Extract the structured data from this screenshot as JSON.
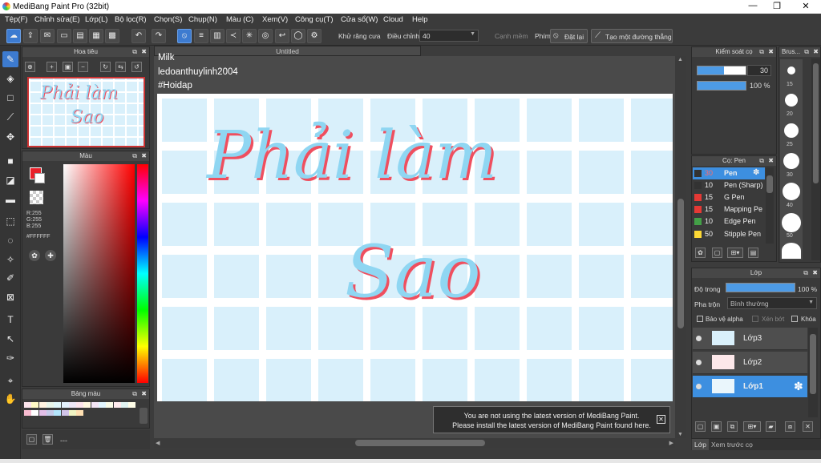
{
  "window": {
    "title": "MediBang Paint Pro (32bit)",
    "minimize": "—",
    "maximize": "❐",
    "close": "✕"
  },
  "menu": [
    "Tệp(F)",
    "Chỉnh sửa(E)",
    "Lớp(L)",
    "Bộ lọc(R)",
    "Chọn(S)",
    "Chụp(N)",
    "Màu (C)",
    "Xem(V)",
    "Công cụ(T)",
    "Cửa sổ(W)",
    "Cloud",
    "Help"
  ],
  "toolbar": {
    "antialias_label": "Khử răng cưa",
    "adjust_label": "Điều chỉnh",
    "adjust_value": "40",
    "edge_label": "Cạnh mềm",
    "phim_label": "Phím",
    "reset_label": "Đặt lại",
    "create_line_label": "Tạo một đường thẳng"
  },
  "document": {
    "tab_title": "Untitled"
  },
  "navigator": {
    "title": "Hoa tiêu",
    "preview_line1": "Phải làm",
    "preview_line2": "Sao"
  },
  "color_panel": {
    "title": "Màu",
    "r": "R:255",
    "g": "G:255",
    "b": "B:255",
    "hex": "#FFFFFF",
    "primary": "#e8202a",
    "secondary": "#ffffff"
  },
  "palette_panel": {
    "title": "Bảng màu",
    "bottom_text": "---",
    "row1": [
      "#fce4ec",
      "#fff9c4",
      "#fff3e0",
      "#e8f5e9",
      "#e0f7fa",
      "#e3f2fd",
      "#ede7f6",
      "#fce4ec",
      "#fff8e1",
      "#f3e5f5",
      "#e1f5fe",
      "#f9fbe7",
      "#ffebee",
      "#e0f2f1",
      "#fffde7"
    ],
    "row2": [
      "#f8bbd0",
      "#ffffff",
      "#e1bee7",
      "#c5cae9",
      "#b3e5fc",
      "#d1c4e9",
      "#f0f4c3",
      "#ffe0b2"
    ]
  },
  "canvas": {
    "overlay_line1": "Milk",
    "overlay_line2": "ledoanthuylinh2004",
    "overlay_line3": "#Hoidap",
    "art_line1": "Phải làm",
    "art_line2": "Sao"
  },
  "notice": {
    "line1": "You are not using the latest version of MediBang Paint.",
    "line2": "Please install the latest version of MediBang Paint found here.",
    "close": "✕"
  },
  "brush_control": {
    "title": "Kiểm soát cọ",
    "size": "30",
    "opacity": "100 %"
  },
  "brush_size_panel": {
    "title": "Brus...",
    "sizes": [
      "15",
      "20",
      "25",
      "30",
      "40",
      "50"
    ]
  },
  "pen_panel": {
    "title": "Cọ: Pen",
    "items": [
      {
        "size": "30",
        "name": "Pen",
        "color": "#333333"
      },
      {
        "size": "10",
        "name": "Pen (Sharp)",
        "color": "#333333"
      },
      {
        "size": "15",
        "name": "G Pen",
        "color": "#e53935"
      },
      {
        "size": "15",
        "name": "Mapping Pe",
        "color": "#e53935"
      },
      {
        "size": "10",
        "name": "Edge Pen",
        "color": "#43a047"
      },
      {
        "size": "50",
        "name": "Stipple Pen",
        "color": "#fdd835"
      }
    ]
  },
  "layer_panel": {
    "title": "Lớp",
    "opacity_label": "Độ trong",
    "opacity_value": "100 %",
    "blend_label": "Pha trộn",
    "blend_value": "Bình thường",
    "protect_alpha": "Bảo vệ alpha",
    "clipping": "Xén bớt",
    "lock": "Khóa",
    "layers": [
      {
        "name": "Lớp3"
      },
      {
        "name": "Lớp2"
      },
      {
        "name": "Lớp1"
      }
    ]
  },
  "bottom_tabs": {
    "layer": "Lớp",
    "preview": "Xem trước cọ"
  }
}
